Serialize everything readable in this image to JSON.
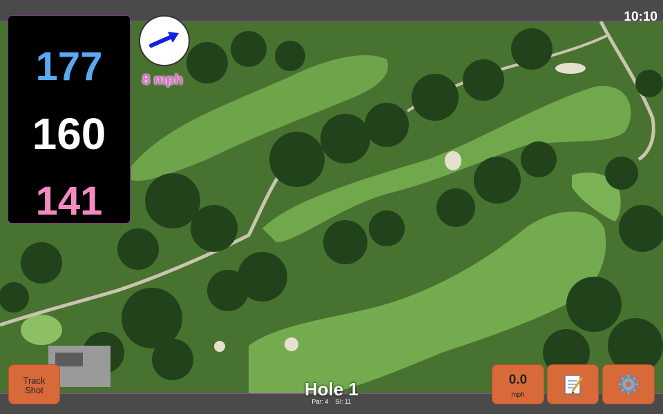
{
  "status": {
    "time": "10:10"
  },
  "distances": {
    "back": "177",
    "middle": "160",
    "front": "141"
  },
  "wind": {
    "speed": "8 mph",
    "icon": "wind-arrow-icon"
  },
  "buttons": {
    "track_shot": {
      "line1": "Track",
      "line2": "Shot"
    },
    "speed": {
      "value": "0.0",
      "unit": "mph"
    },
    "notes": {
      "icon": "notepad-icon"
    },
    "settings": {
      "icon": "gear-icon"
    }
  },
  "hole": {
    "title": "Hole 1",
    "par": "Par: 4",
    "si": "SI: 11"
  },
  "colors": {
    "back": "#5aa9f2",
    "middle": "#ffffff",
    "front": "#f58ac2",
    "accent_button": "#d86a3a",
    "wind_text": "#f05ce0"
  }
}
